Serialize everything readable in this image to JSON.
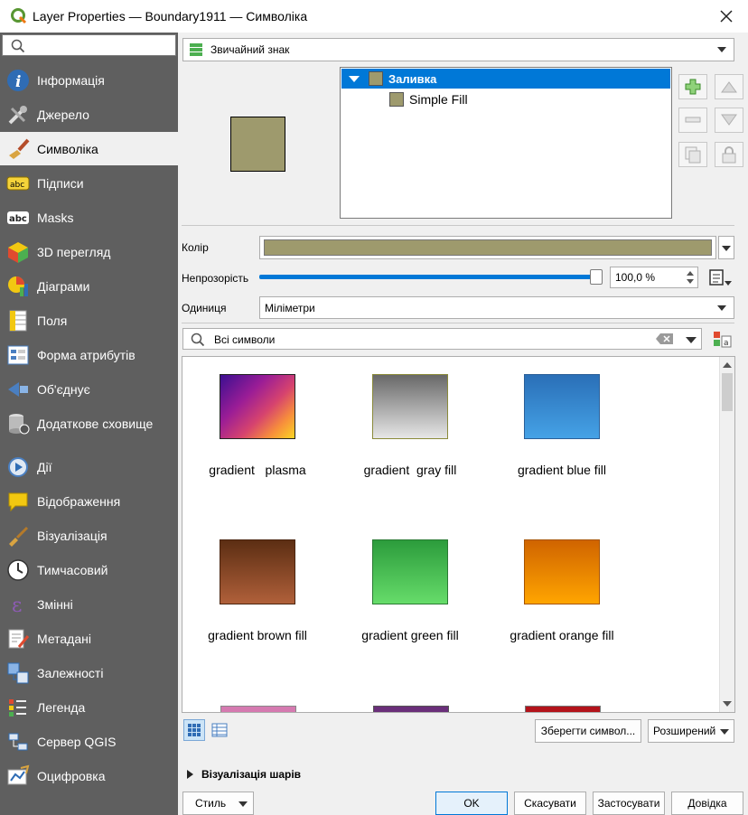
{
  "window": {
    "title": "Layer Properties — Boundary1911 — Символіка"
  },
  "sidebar": {
    "items": [
      {
        "label": "Інформація",
        "icon": "info-icon"
      },
      {
        "label": "Джерело",
        "icon": "source-icon"
      },
      {
        "label": "Символіка",
        "icon": "symbology-icon"
      },
      {
        "label": "Підписи",
        "icon": "labels-icon"
      },
      {
        "label": "Masks",
        "icon": "masks-icon"
      },
      {
        "label": "3D перегляд",
        "icon": "3d-view-icon"
      },
      {
        "label": "Діаграми",
        "icon": "diagrams-icon"
      },
      {
        "label": "Поля",
        "icon": "fields-icon"
      },
      {
        "label": "Форма атрибутів",
        "icon": "attributes-form-icon"
      },
      {
        "label": "Об'єднує",
        "icon": "joins-icon"
      },
      {
        "label": "Додаткове сховище",
        "icon": "auxiliary-storage-icon"
      },
      {
        "label": "Дії",
        "icon": "actions-icon"
      },
      {
        "label": "Відображення",
        "icon": "display-icon"
      },
      {
        "label": "Візуалізація",
        "icon": "rendering-icon"
      },
      {
        "label": "Тимчасовий",
        "icon": "temporal-icon"
      },
      {
        "label": "Змінні",
        "icon": "variables-icon"
      },
      {
        "label": "Метадані",
        "icon": "metadata-icon"
      },
      {
        "label": "Залежності",
        "icon": "dependencies-icon"
      },
      {
        "label": "Легенда",
        "icon": "legend-icon"
      },
      {
        "label": "Сервер QGIS",
        "icon": "qgis-server-icon"
      },
      {
        "label": "Оцифровка",
        "icon": "digitizing-icon"
      }
    ],
    "active": "Символіка"
  },
  "renderer": {
    "value": "Звичайний знак"
  },
  "symbol_tree": {
    "root": "Заливка",
    "child": "Simple Fill"
  },
  "colors": {
    "fill": "#9e9a6d",
    "accent": "#0078d7"
  },
  "properties": {
    "color_label": "Колір",
    "opacity_label": "Непрозорість",
    "opacity_value": "100,0 %",
    "opacity_fraction": 1.0,
    "unit_label": "Одиниця",
    "unit_value": "Міліметри"
  },
  "library": {
    "filter_value": "Всі символи",
    "symbols": [
      {
        "name": "gradient   plasma",
        "colors": [
          "#3b0f91",
          "#d6436e",
          "#fbd524"
        ]
      },
      {
        "name": "gradient  gray fill",
        "colors": [
          "#686868",
          "#e6e6e6"
        ]
      },
      {
        "name": "gradient blue fill",
        "colors": [
          "#2a6fb7",
          "#45a2e6"
        ]
      },
      {
        "name": "gradient brown fill",
        "colors": [
          "#5c2e13",
          "#b0603a"
        ]
      },
      {
        "name": "gradient green fill",
        "colors": [
          "#2c9c3c",
          "#66dc6a"
        ]
      },
      {
        "name": "gradient orange fill",
        "colors": [
          "#d06400",
          "#ffa500"
        ]
      }
    ],
    "save_label": "Зберегти символ...",
    "advanced_label": "Розширений"
  },
  "layer_rendering": {
    "label": "Візуалізація шарів"
  },
  "footer": {
    "style_label": "Стиль",
    "ok_label": "OK",
    "cancel_label": "Скасувати",
    "apply_label": "Застосувати",
    "help_label": "Довідка"
  }
}
